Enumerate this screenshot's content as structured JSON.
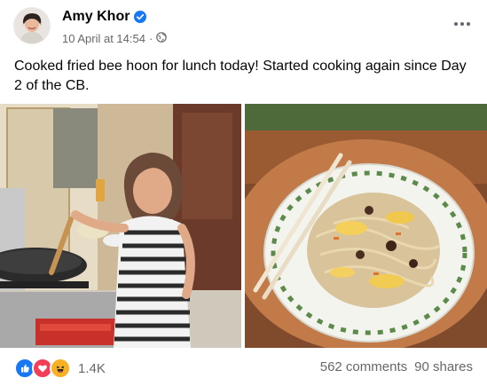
{
  "post": {
    "author": "Amy Khor",
    "timestamp": "10 April at 14:54",
    "separator": "·",
    "audience_icon": "globe-icon",
    "text": "Cooked fried bee hoon for lunch today! Started cooking again since Day 2 of the CB."
  },
  "reactions": {
    "icons": [
      "like-icon",
      "love-icon",
      "haha-icon"
    ],
    "count": "1.4K",
    "comments": "562 comments",
    "shares": "90 shares"
  },
  "colors": {
    "like": "#1877f2",
    "love": "#f33e58",
    "haha": "#f7b125",
    "verified": "#1877f2",
    "secondary_text": "#65676b"
  }
}
